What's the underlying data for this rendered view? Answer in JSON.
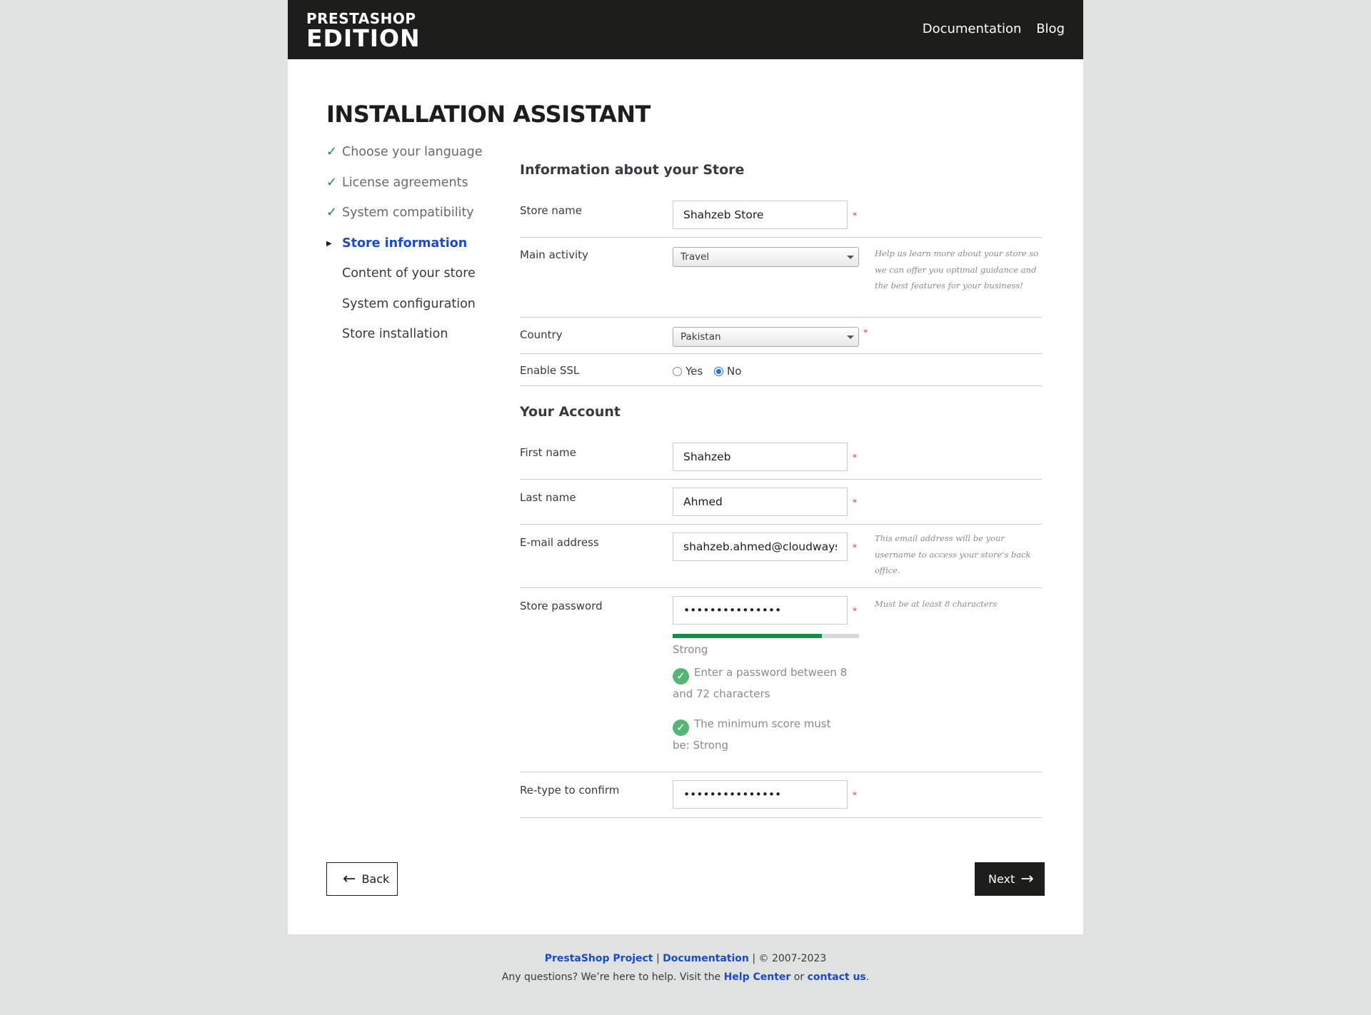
{
  "header": {
    "logo_line1": "PRESTASHOP",
    "logo_line2": "EDITION",
    "nav": [
      "Documentation",
      "Blog"
    ]
  },
  "title": "INSTALLATION ASSISTANT",
  "steps": [
    {
      "label": "Choose your language",
      "state": "done"
    },
    {
      "label": "License agreements",
      "state": "done"
    },
    {
      "label": "System compatibility",
      "state": "done"
    },
    {
      "label": "Store information",
      "state": "active"
    },
    {
      "label": "Content of your store",
      "state": "todo"
    },
    {
      "label": "System configuration",
      "state": "todo"
    },
    {
      "label": "Store installation",
      "state": "todo"
    }
  ],
  "store_section": {
    "title": "Information about your Store",
    "store_name": {
      "label": "Store name",
      "value": "Shahzeb Store"
    },
    "main_activity": {
      "label": "Main activity",
      "value": "Travel",
      "hint": "Help us learn more about your store so we can offer you optimal guidance and the best features for your business!"
    },
    "country": {
      "label": "Country",
      "value": "Pakistan"
    },
    "ssl": {
      "label": "Enable SSL",
      "yes": "Yes",
      "no": "No",
      "selected": "No"
    }
  },
  "account_section": {
    "title": "Your Account",
    "first_name": {
      "label": "First name",
      "value": "Shahzeb"
    },
    "last_name": {
      "label": "Last name",
      "value": "Ahmed"
    },
    "email": {
      "label": "E-mail address",
      "value": "shahzeb.ahmed@cloudways.com",
      "hint": "This email address will be your username to access your store's back office."
    },
    "password": {
      "label": "Store password",
      "value": "•••••••••••••••",
      "hint": "Must be at least 8 characters",
      "strength_label": "Strong",
      "strength_fraction": 0.8,
      "rule1": "Enter a password between 8 and 72 characters",
      "rule2": "The minimum score must be: Strong"
    },
    "confirm": {
      "label": "Re-type to confirm",
      "value": "•••••••••••••••"
    }
  },
  "buttons": {
    "back": "Back",
    "next": "Next"
  },
  "footer": {
    "project_link": "PrestaShop Project",
    "sep1": "|",
    "docs_link": "Documentation",
    "copyright": "| © 2007-2023",
    "help_text": "Any questions? We’re here to help. Visit the",
    "help_link": "Help Center",
    "or": "or",
    "contact_link": "contact us",
    "period": "."
  },
  "colors": {
    "accent": "#1a49d6",
    "success": "#1a8a46",
    "required": "#e6322e",
    "dark": "#1d1d1b"
  }
}
